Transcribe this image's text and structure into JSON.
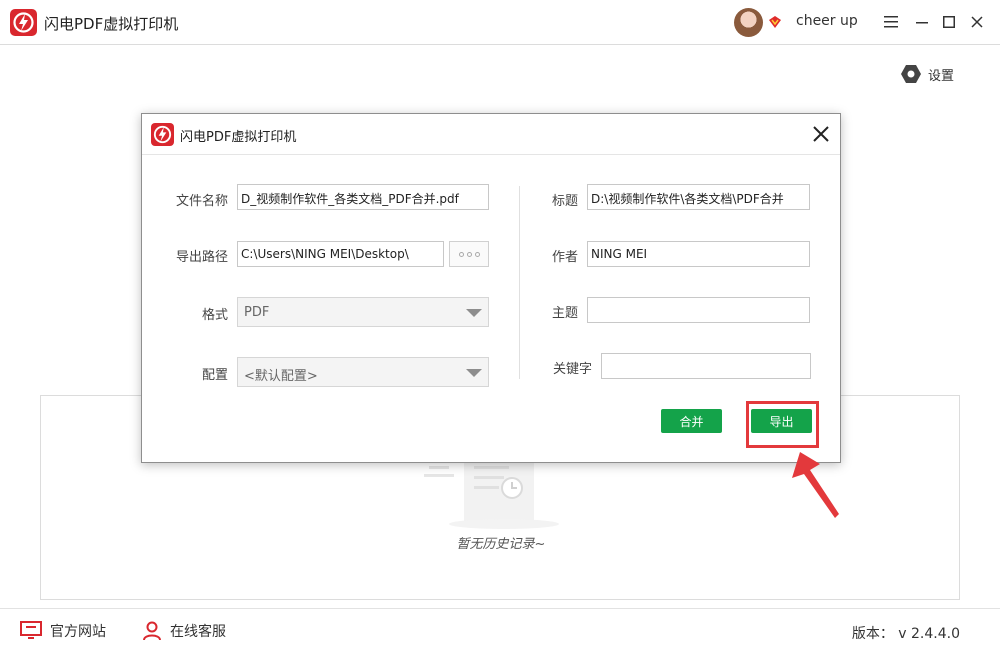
{
  "app": {
    "title": "闪电PDF虚拟打印机",
    "username": "cheer up",
    "settings_label": "设置"
  },
  "history": {
    "empty_text": "暂无历史记录~"
  },
  "footer": {
    "website_label": "官方网站",
    "service_label": "在线客服",
    "version": "版本： v 2.4.4.0"
  },
  "dialog": {
    "title": "闪电PDF虚拟打印机",
    "file_name_label": "文件名称",
    "file_name_value": "D_视频制作软件_各类文档_PDF合并.pdf",
    "export_path_label": "导出路径",
    "export_path_value": "C:\\Users\\NING MEI\\Desktop\\",
    "format_label": "格式",
    "format_value": "PDF",
    "config_label": "配置",
    "config_value": "<默认配置>",
    "title_label": "标题",
    "title_value": "D:\\视频制作软件\\各类文档\\PDF合并",
    "author_label": "作者",
    "author_value": "NING MEI",
    "subject_label": "主题",
    "subject_value": "",
    "keywords_label": "关键字",
    "keywords_value": "",
    "merge_button": "合并",
    "export_button": "导出"
  },
  "colors": {
    "brand_red": "#d9272e",
    "button_green": "#14a34a",
    "highlight_red": "#e3393c"
  },
  "icons": [
    "app-logo-icon",
    "vip-icon",
    "menu-icon",
    "minimize-icon",
    "maximize-icon",
    "close-icon",
    "gear-icon",
    "monitor-icon",
    "person-icon",
    "browse-icon",
    "dropdown-icon",
    "history-empty-icon"
  ]
}
